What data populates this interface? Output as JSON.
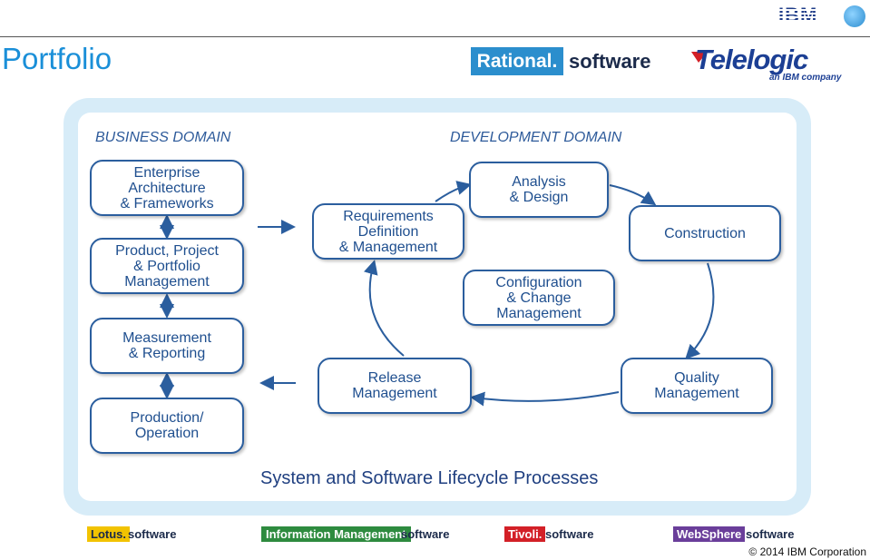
{
  "header": {
    "title": "Portfolio",
    "ibm_logo": "IBM",
    "rational_label": "Rational.",
    "rational_software": "software",
    "telelogic_name": "Telelogic",
    "telelogic_sub": "an IBM company"
  },
  "domains": {
    "business": "BUSINESS DOMAIN",
    "development": "DEVELOPMENT DOMAIN"
  },
  "business_boxes": [
    "Enterprise\nArchitecture\n& Frameworks",
    "Product, Project\n& Portfolio\nManagement",
    "Measurement\n& Reporting",
    "Production/\nOperation"
  ],
  "lifecycle_boxes": {
    "requirements": "Requirements\nDefinition\n& Management",
    "analysis": "Analysis\n& Design",
    "construction": "Construction",
    "configuration": "Configuration\n& Change\nManagement",
    "quality": "Quality\nManagement",
    "release": "Release\nManagement"
  },
  "caption": "System and Software Lifecycle Processes",
  "footer_brands": {
    "lotus": "Lotus.",
    "lotus_sw": "software",
    "im": "Information Management",
    "im_sw": "software",
    "tivoli": "Tivoli.",
    "tivoli_sw": "software",
    "websphere": "WebSphere",
    "websphere_sw": "software"
  },
  "copyright": "© 2014 IBM Corporation",
  "colors": {
    "title": "#1a8fd8",
    "box_border": "#2b5e9e",
    "arrow": "#2b5e9e",
    "frame": "#d7ecf8",
    "lotus": "#f2c300",
    "im": "#2e8b3f",
    "tivoli": "#d32027",
    "websphere": "#6a3e9a"
  }
}
